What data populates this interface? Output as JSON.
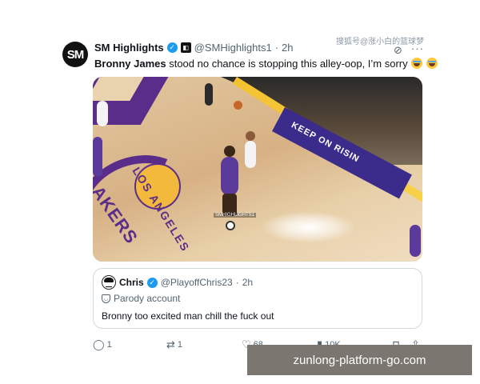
{
  "tweet": {
    "avatar_text": "SM",
    "name": "SM Highlights",
    "handle": "@SMHighlights1",
    "separator": "·",
    "time": "2h",
    "text_bold": "Bronny James",
    "text_rest": " stood no chance is stopping this alley-oop, I’m sorry",
    "icons": [
      "verified-badge-icon",
      "org-badge-icon",
      "grok-icon",
      "more-icon",
      "crying-emoji-icon"
    ]
  },
  "source_watermark": "搜狐号@涨小白的篮球梦",
  "video": {
    "adboard_text": "KEEP ON RISIN",
    "floor_text": "LOS ANGELES",
    "floor_text2": "LAKERS",
    "watermark": "SMHIGHLIGHTS1"
  },
  "quote": {
    "name": "Chris",
    "handle": "@PlayoffChris23",
    "separator": "·",
    "time": "2h",
    "label": "Parody account",
    "text": "Bronny too excited man chill the fuck out"
  },
  "actions": {
    "replies": "1",
    "reposts": "1",
    "likes": "68",
    "views": "10K"
  },
  "url_banner": "zunlong-platform-go.com",
  "colors": {
    "accent": "#1d9bf0",
    "lakers_purple": "#5b2d8a",
    "lakers_gold": "#f3b93c",
    "banner_bg": "#7b7670"
  }
}
